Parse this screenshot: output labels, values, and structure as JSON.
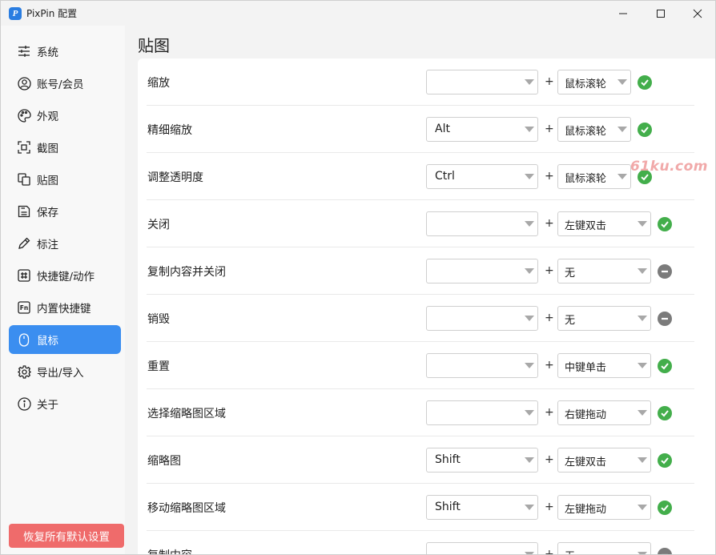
{
  "window": {
    "title": "PixPin 配置",
    "logo_letter": "P"
  },
  "sidebar": {
    "items": [
      {
        "label": "系统",
        "icon": "sliders-icon"
      },
      {
        "label": "账号/会员",
        "icon": "user-circle-icon"
      },
      {
        "label": "外观",
        "icon": "palette-icon"
      },
      {
        "label": "截图",
        "icon": "screenshot-frame-icon"
      },
      {
        "label": "贴图",
        "icon": "pin-copy-icon"
      },
      {
        "label": "保存",
        "icon": "save-icon"
      },
      {
        "label": "标注",
        "icon": "pencil-icon"
      },
      {
        "label": "快捷键/动作",
        "icon": "hash-icon"
      },
      {
        "label": "内置快捷键",
        "icon": "fn-key-icon"
      },
      {
        "label": "鼠标",
        "icon": "mouse-icon",
        "active": true
      },
      {
        "label": "导出/导入",
        "icon": "gear-icon"
      },
      {
        "label": "关于",
        "icon": "info-icon"
      }
    ],
    "reset_label": "恢复所有默认设置"
  },
  "main": {
    "title": "贴图",
    "plus": "+",
    "rows": [
      {
        "label": "缩放",
        "modifier": "",
        "action": "鼠标滚轮",
        "status": "ok"
      },
      {
        "label": "精细缩放",
        "modifier": "Alt",
        "action": "鼠标滚轮",
        "status": "ok"
      },
      {
        "label": "调整透明度",
        "modifier": "Ctrl",
        "action": "鼠标滚轮",
        "status": "ok"
      },
      {
        "label": "关闭",
        "modifier": "",
        "action": "左键双击",
        "status": "ok"
      },
      {
        "label": "复制内容并关闭",
        "modifier": "",
        "action": "无",
        "status": "none"
      },
      {
        "label": "销毁",
        "modifier": "",
        "action": "无",
        "status": "none"
      },
      {
        "label": "重置",
        "modifier": "",
        "action": "中键单击",
        "status": "ok"
      },
      {
        "label": "选择缩略图区域",
        "modifier": "",
        "action": "右键拖动",
        "status": "ok"
      },
      {
        "label": "缩略图",
        "modifier": "Shift",
        "action": "左键双击",
        "status": "ok"
      },
      {
        "label": "移动缩略图区域",
        "modifier": "Shift",
        "action": "左键拖动",
        "status": "ok"
      },
      {
        "label": "复制内容",
        "modifier": "",
        "action": "无",
        "status": "none"
      }
    ]
  },
  "watermark": "61ku.com",
  "colors": {
    "accent": "#3b8ef0",
    "ok": "#43ae4b",
    "none": "#7b7b7b",
    "reset": "#ef6b6b"
  }
}
